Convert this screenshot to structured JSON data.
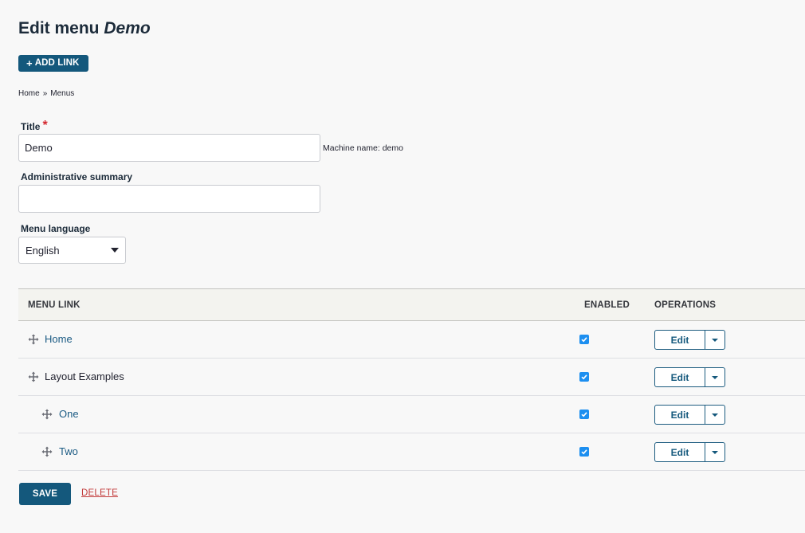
{
  "page": {
    "title_prefix": "Edit menu",
    "title_menu_name": "Demo"
  },
  "toolbar": {
    "add_link_icon": "plus-icon",
    "add_link_label": "Add link"
  },
  "breadcrumb": {
    "items": [
      "Home",
      "Menus"
    ],
    "separator": "»"
  },
  "form": {
    "title_label": "Title",
    "title_required_mark": "*",
    "title_value": "Demo",
    "machine_name": "Machine name: demo",
    "summary_label": "Administrative summary",
    "summary_value": "",
    "language_label": "Menu language",
    "language_value": "English"
  },
  "table": {
    "headers": {
      "menu_link": "Menu link",
      "enabled": "Enabled",
      "operations": "Operations"
    },
    "rows": [
      {
        "label": "Home",
        "enabled": true,
        "depth": 0,
        "is_link": true,
        "edit_label": "Edit"
      },
      {
        "label": "Layout Examples",
        "enabled": true,
        "depth": 0,
        "is_link": false,
        "edit_label": "Edit"
      },
      {
        "label": "One",
        "enabled": true,
        "depth": 1,
        "is_link": true,
        "edit_label": "Edit"
      },
      {
        "label": "Two",
        "enabled": true,
        "depth": 1,
        "is_link": true,
        "edit_label": "Edit"
      }
    ]
  },
  "actions": {
    "save_label": "Save",
    "delete_label": "Delete"
  },
  "colors": {
    "primary_button": "#14587c",
    "link": "#1a5a83",
    "required": "#d4262d",
    "delete": "#c23a3a",
    "checkbox": "#1d8ff0"
  },
  "icons": {
    "drag_handle": "drag-handle-icon",
    "checkbox_check": "check-icon",
    "dropdown": "caret-down-icon"
  }
}
